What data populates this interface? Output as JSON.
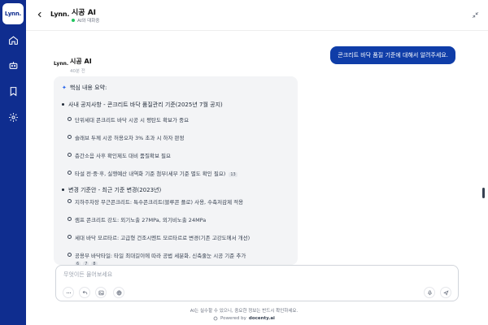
{
  "sidebar": {
    "logo_text": "Lynn.",
    "items": [
      {
        "name": "home"
      },
      {
        "name": "robot"
      },
      {
        "name": "bookmark"
      },
      {
        "name": "settings"
      }
    ]
  },
  "header": {
    "brand": "Lynn.",
    "title": "시공 AI",
    "subtitle": "AI와 대화중"
  },
  "messages": {
    "user_text": "콘크리트 바닥 품질 기준에 대해서 알려주세요.",
    "ai_logo": "Lynn.",
    "ai_name": "시공 AI",
    "ai_time": "40분 전",
    "summary_title": "핵심 내용 요약:",
    "section1_title": "사내 공지사항 - 콘크리트 바닥 품질관리 기준(2025년 7월 공지)",
    "section1_items": [
      "단위세대 콘크리트 바닥 시공 시 평탄도 확보가 중요",
      "슬래브 두께 시공 허용오차 3% 초과 시 하자 판정",
      "층간소음 사후 확인제도 대비 품질확보 필요",
      "타설 전·중·후, 실행예산 내역화 기준 첨부(세부 기준 별도 확인 필요)"
    ],
    "section1_cite": "13",
    "section2_title": "변경 기준안 - 최근 기준 변경(2023년)",
    "section2_items": [
      "지하주차장 무근콘크리트: 특수콘크리트(블루콘 플로) 사용, 수축저감제 적용",
      "램프 콘크리트 강도: 외기노출 27MPa, 외기비노출 24MPa",
      "세대 바닥 모르타르: 고급형 건조시멘트 모르타르로 변경(기존 고강도에서 개선)",
      "공용부 바닥타일: 타일 최대길이에 따라 공법 세분화, 신축줄눈 시공 기준 추가"
    ],
    "section2_cites": [
      "6",
      "7",
      "8"
    ]
  },
  "input": {
    "placeholder": "무엇이든 물어보세요"
  },
  "footer": {
    "disclaimer": "AI는 실수할 수 있으니, 중요한 정보는 반드시 확인하세요.",
    "powered_prefix": "Powered by",
    "powered_brand": "docenty.ai"
  },
  "colors": {
    "sidebar": "#0f2d8f",
    "user_bubble": "#0f3da8",
    "online": "#22c55e"
  }
}
